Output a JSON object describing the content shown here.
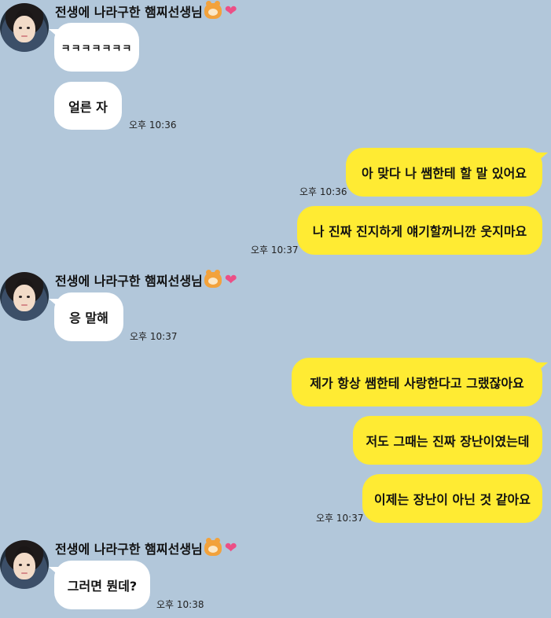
{
  "chat": {
    "sender_name": "전생에 나라구한 햄찌선생님",
    "groups": [
      {
        "messages": [
          "ㅋㅋㅋㅋㅋㅋㅋ",
          "얼른 자"
        ],
        "time": "오후 10:36"
      },
      {
        "messages": [
          "응 말해"
        ],
        "time": "오후 10:37"
      },
      {
        "messages": [
          "그러면 뭔데?"
        ],
        "time": "오후 10:38"
      }
    ],
    "sent": [
      {
        "text": "아 맞다 나 쌤한테 할 말 있어요",
        "time": "오후 10:36"
      },
      {
        "text": "나 진짜 진지하게 얘기할꺼니깐 웃지마요",
        "time": "오후 10:37"
      },
      {
        "text": "제가 항상 쌤한테 사랑한다고 그랬잖아요"
      },
      {
        "text": "저도 그때는 진짜 장난이였는데"
      },
      {
        "text": "이제는 장난이 아닌 것 같아요",
        "time": "오후 10:37"
      }
    ]
  },
  "colors": {
    "background": "#b2c7da",
    "sent_bubble": "#ffeb33",
    "received_bubble": "#ffffff",
    "heart": "#ec4f86"
  },
  "icons": [
    "profile-avatar",
    "hamster-emoji-icon",
    "heart-emoji-icon"
  ]
}
